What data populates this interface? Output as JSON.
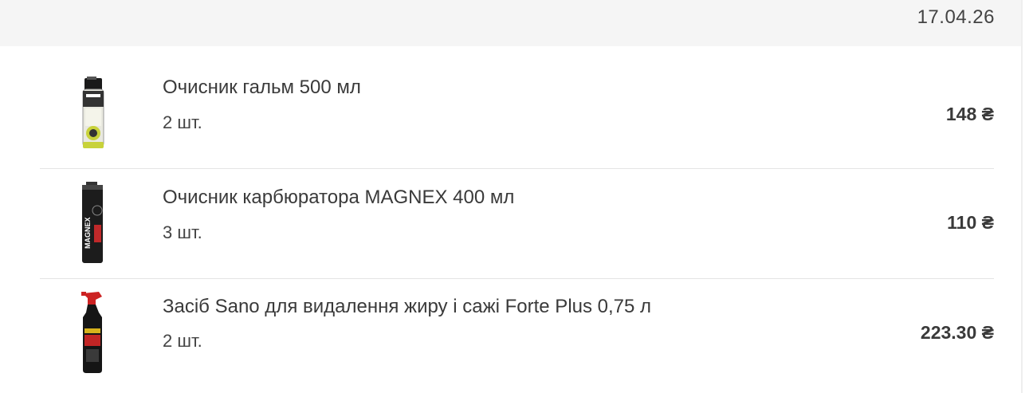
{
  "order": {
    "date": "17.04.26",
    "items": [
      {
        "image": "brake-cleaner-can-icon",
        "name": "Очисник гальм 500 мл",
        "qty": "2 шт.",
        "price": "148 ₴"
      },
      {
        "image": "carburetor-cleaner-can-icon",
        "name": "Очисник карбюратора MAGNEX 400 мл",
        "qty": "3 шт.",
        "price": "110 ₴"
      },
      {
        "image": "spray-bottle-icon",
        "name": "Засіб Sano для видалення жиру і сажі Forte Plus 0,75 л",
        "qty": "2 шт.",
        "price": "223.30 ₴"
      }
    ]
  },
  "colors": {
    "header_bg": "#f5f5f5",
    "text": "#333333",
    "divider": "#e4e4e4"
  }
}
